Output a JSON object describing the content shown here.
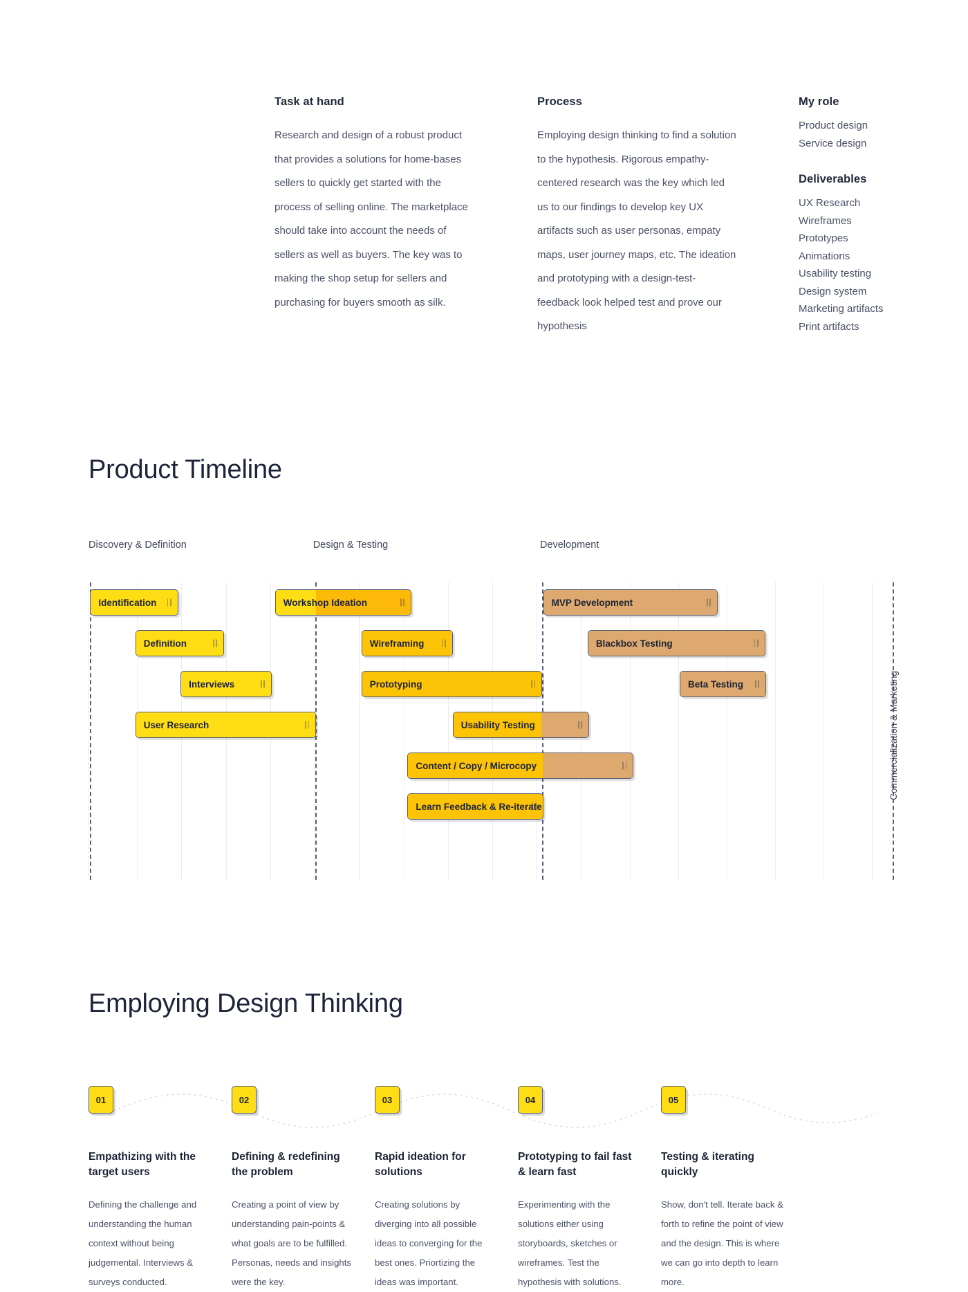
{
  "colors": {
    "accent_yellow": "#ffdd15",
    "accent_yellow_dark": "#fcc307",
    "accent_tan": "#dda96f",
    "ink": "#1c2335",
    "muted": "#4a5166",
    "grid": "#ececec",
    "dash": "#585f78"
  },
  "intro": {
    "task": {
      "heading": "Task at hand",
      "body": "Research and design of a robust product that provides a solutions for home-bases sellers to quickly get started with the process of selling online. The marketplace should take into account the needs of sellers as well as buyers. The key was to making the shop setup for sellers and purchasing for buyers smooth as silk."
    },
    "process": {
      "heading": "Process",
      "body": "Employing design thinking to find a solution to the hypothesis. Rigorous empathy-centered research was the key which led us to our findings to develop key UX artifacts such as user personas, empaty maps,  user journey maps, etc. The ideation and prototyping with a design-test-feedback look helped test and prove our hypothesis"
    },
    "role": {
      "heading": "My role",
      "items": [
        "Product design",
        "Service design"
      ]
    },
    "deliverables": {
      "heading": "Deliverables",
      "items": [
        "UX Research",
        "Wireframes",
        "Prototypes",
        "Animations",
        "Usability testing",
        "Design system",
        "Marketing artifacts",
        "Print artifacts"
      ]
    }
  },
  "timeline": {
    "title": "Product Timeline",
    "side_note": "Commercialization & Marketing",
    "phases": [
      {
        "label": "Discovery & Definition",
        "x_pct": 0
      },
      {
        "label": "Design & Testing",
        "x_pct": 27.8
      },
      {
        "label": "Development",
        "x_pct": 55.9
      }
    ],
    "gridlines_pct": [
      0,
      6,
      11.5,
      17,
      22.5,
      28,
      33.5,
      39,
      44.5,
      50,
      55.5,
      61,
      67,
      73,
      79,
      85,
      91,
      97
    ],
    "boundaries_pct": [
      0.2,
      28.1,
      56.2,
      99.6
    ],
    "bars": [
      {
        "label": "Identification",
        "left_pct": 0.2,
        "width_pct": 10.9,
        "row": 0,
        "fills": [
          {
            "color": "#ffdd15",
            "pct": 100
          }
        ]
      },
      {
        "label": "Workshop Ideation",
        "left_pct": 23.1,
        "width_pct": 16.9,
        "row": 0,
        "fills": [
          {
            "color": "#ffdd15",
            "pct": 30
          },
          {
            "color": "#fcb908",
            "pct": 70
          }
        ]
      },
      {
        "label": "MVP Development",
        "left_pct": 56.3,
        "width_pct": 21.6,
        "row": 0,
        "fills": [
          {
            "color": "#dda96f",
            "pct": 100
          }
        ]
      },
      {
        "label": "Definition",
        "left_pct": 5.8,
        "width_pct": 11.0,
        "row": 1,
        "fills": [
          {
            "color": "#ffdd15",
            "pct": 100
          }
        ]
      },
      {
        "label": "Wireframing",
        "left_pct": 33.8,
        "width_pct": 11.3,
        "row": 1,
        "fills": [
          {
            "color": "#fcc307",
            "pct": 100
          }
        ]
      },
      {
        "label": "Blackbox Testing",
        "left_pct": 61.8,
        "width_pct": 22.0,
        "row": 1,
        "fills": [
          {
            "color": "#dda96f",
            "pct": 100
          }
        ]
      },
      {
        "label": "Interviews",
        "left_pct": 11.4,
        "width_pct": 11.3,
        "row": 2,
        "fills": [
          {
            "color": "#ffdd15",
            "pct": 100
          }
        ]
      },
      {
        "label": "Prototyping",
        "left_pct": 33.8,
        "width_pct": 22.4,
        "row": 2,
        "fills": [
          {
            "color": "#fcc307",
            "pct": 100
          }
        ]
      },
      {
        "label": "Beta Testing",
        "left_pct": 73.2,
        "width_pct": 10.7,
        "row": 2,
        "fills": [
          {
            "color": "#dda96f",
            "pct": 100
          }
        ]
      },
      {
        "label": "User Research",
        "left_pct": 5.8,
        "width_pct": 22.4,
        "row": 3,
        "fills": [
          {
            "color": "#ffdd15",
            "pct": 100
          }
        ]
      },
      {
        "label": "Usability Testing",
        "left_pct": 45.1,
        "width_pct": 16.9,
        "row": 3,
        "fills": [
          {
            "color": "#fcc307",
            "pct": 65
          },
          {
            "color": "#dda96f",
            "pct": 35
          }
        ]
      },
      {
        "label": "Content / Copy / Microcopy",
        "left_pct": 39.5,
        "width_pct": 28.0,
        "row": 4,
        "fills": [
          {
            "color": "#fcc307",
            "pct": 60
          },
          {
            "color": "#dda96f",
            "pct": 40
          }
        ]
      },
      {
        "label": "Learn Feedback & Re-iterate",
        "left_pct": 39.5,
        "width_pct": 16.8,
        "row": 5,
        "fills": [
          {
            "color": "#fcc307",
            "pct": 100
          }
        ]
      }
    ]
  },
  "design_thinking": {
    "title": "Employing Design Thinking",
    "steps": [
      {
        "number": "01",
        "heading": "Empathizing with the target users",
        "text": "Defining the challenge and understanding the human context without being judgemental. Interviews & surveys conducted."
      },
      {
        "number": "02",
        "heading": "Defining & redefining the problem",
        "text": "Creating a point of view by understanding pain-points & what goals are to be fulfilled. Personas, needs and insights were the key."
      },
      {
        "number": "03",
        "heading": "Rapid ideation for solutions",
        "text": "Creating solutions by diverging into all possible ideas to converging for the best ones. Priortizing the ideas was important."
      },
      {
        "number": "04",
        "heading": "Prototyping to fail fast & learn fast",
        "text": "Experimenting with the solutions either using storyboards, sketches or wireframes. Test the hypothesis with solutions."
      },
      {
        "number": "05",
        "heading": "Testing & iterating quickly",
        "text": "Show, don't tell. Iterate back & forth to refine the point of view and the design. This is where we can go into depth to learn more."
      }
    ]
  }
}
